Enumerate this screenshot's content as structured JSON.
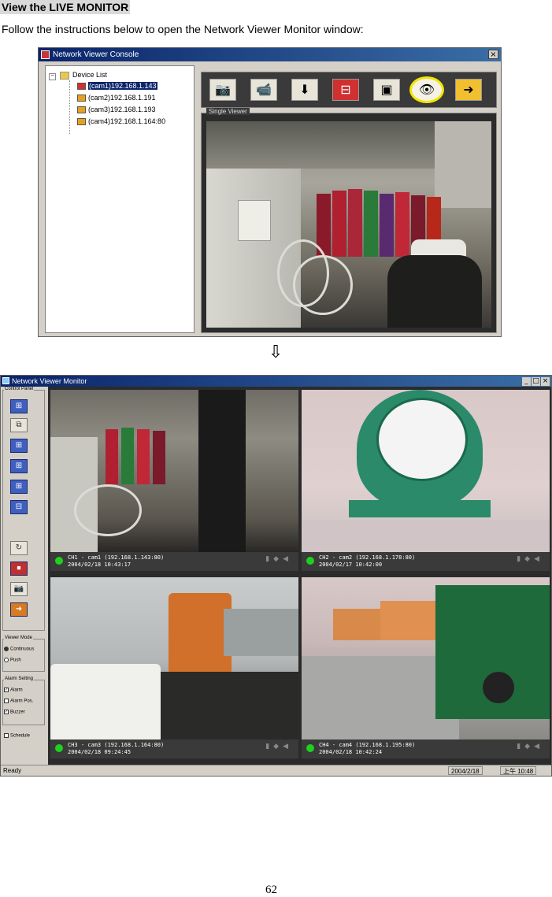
{
  "heading": "View the LIVE MONITOR",
  "instruction": "Follow the instructions below to open the Network Viewer Monitor window:",
  "console": {
    "title": "Network Viewer Console",
    "close": "×",
    "tree_root": "Device List",
    "devices": [
      {
        "label": "(cam1)192.168.1.143",
        "color": "#d03030",
        "selected": true
      },
      {
        "label": "(cam2)192.168.1.191",
        "color": "#e8a020",
        "selected": false
      },
      {
        "label": "(cam3)192.168.1.193",
        "color": "#e8a020",
        "selected": false
      },
      {
        "label": "(cam4)192.168.1.164:80",
        "color": "#e8a020",
        "selected": false
      }
    ],
    "toolbar_icons": [
      "add-camera-icon",
      "remove-camera-icon",
      "download-icon",
      "split-view-icon",
      "camera-settings-icon",
      "eye-icon",
      "exit-icon"
    ],
    "viewer_label": "Single Viewer"
  },
  "arrow": "⇩",
  "monitor": {
    "title": "Network Viewer Monitor",
    "window_controls": [
      "_",
      "□",
      "×"
    ],
    "control_panel_label": "Control Panel",
    "viewer_mode_label": "Viewer Mode",
    "viewer_modes": [
      "Continuous",
      "Push"
    ],
    "alarm_setting_label": "Alarm Setting",
    "alarm_options": [
      "Alarm",
      "Alarm Pos.",
      "Buzzer"
    ],
    "schedule_label": "Schedule",
    "cameras": [
      {
        "line1": "CH1 - cam1 (192.168.1.143:80)",
        "line2": "2004/02/18  10:43:17"
      },
      {
        "line1": "CH2 - cam2 (192.168.1.178:80)",
        "line2": "2004/02/17  10:42:00"
      },
      {
        "line1": "CH3 - cam3 (192.168.1.164:80)",
        "line2": "2004/02/18  09:24:45"
      },
      {
        "line1": "CH4 - cam4 (192.168.1.195:80)",
        "line2": "2004/02/18  10:42:24"
      }
    ],
    "status_ready": "Ready",
    "status_date": "2004/2/18",
    "status_time": "上午 10:48"
  },
  "page_number": "62"
}
